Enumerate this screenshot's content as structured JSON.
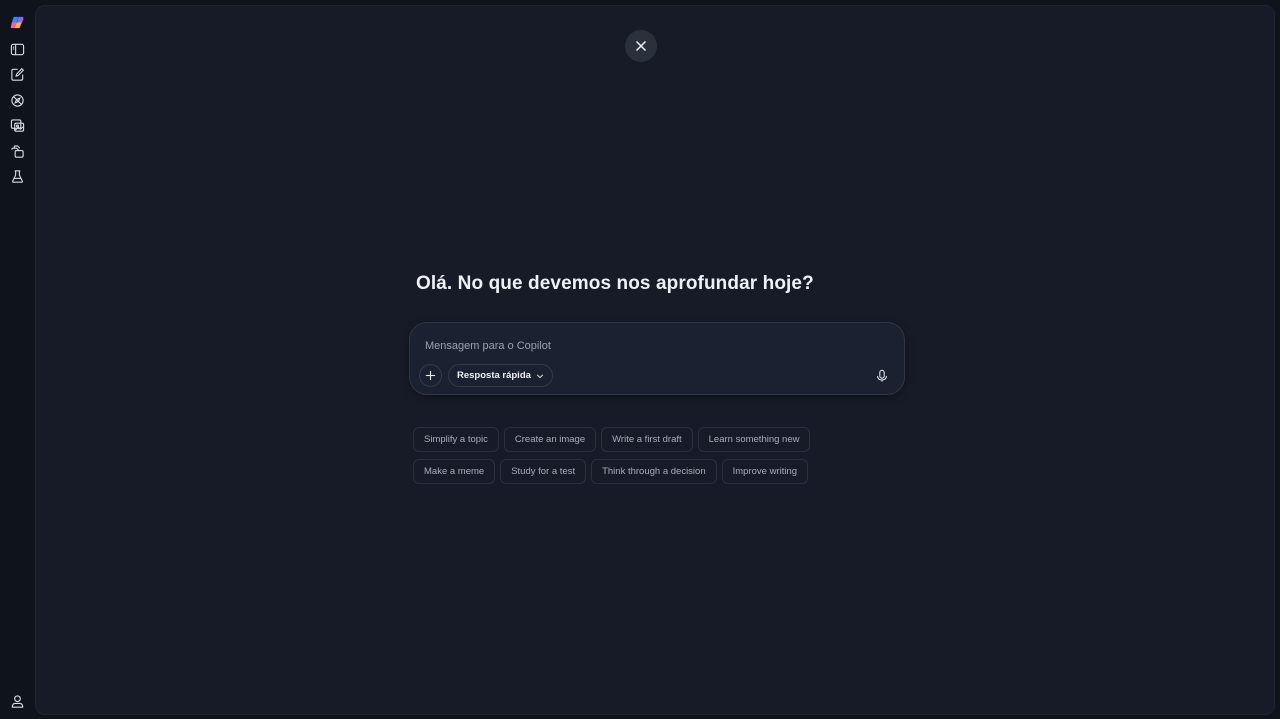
{
  "sidebar": {
    "items": [
      {
        "name": "copilot-logo",
        "icon": "copilot-logo-icon"
      },
      {
        "name": "toggle-sidebar",
        "icon": "sidebar-panel-icon"
      },
      {
        "name": "new-chat",
        "icon": "compose-icon"
      },
      {
        "name": "discover",
        "icon": "compass-icon"
      },
      {
        "name": "imagine",
        "icon": "image-gallery-icon"
      },
      {
        "name": "library",
        "icon": "copy-pages-icon"
      },
      {
        "name": "labs",
        "icon": "flask-icon"
      }
    ],
    "profile_icon": "user-icon"
  },
  "main": {
    "close_icon": "close-icon",
    "greeting": "Olá. No que devemos nos aprofundar hoje?",
    "composer": {
      "placeholder": "Mensagem para o Copilot",
      "value": "",
      "mode_label": "Resposta rápida",
      "plus_icon": "plus-icon",
      "mode_icon": "chevron-down-icon",
      "mic_icon": "microphone-icon"
    },
    "suggestions_row1": [
      "Simplify a topic",
      "Create an image",
      "Write a first draft",
      "Learn something new"
    ],
    "suggestions_row2": [
      "Make a meme",
      "Study for a test",
      "Think through a decision",
      "Improve writing"
    ]
  },
  "colors": {
    "background": "#0f131c",
    "panel": "#161b27",
    "composer": "#1b2130",
    "text_primary": "#eef0f5",
    "text_secondary": "#a6adbb"
  }
}
